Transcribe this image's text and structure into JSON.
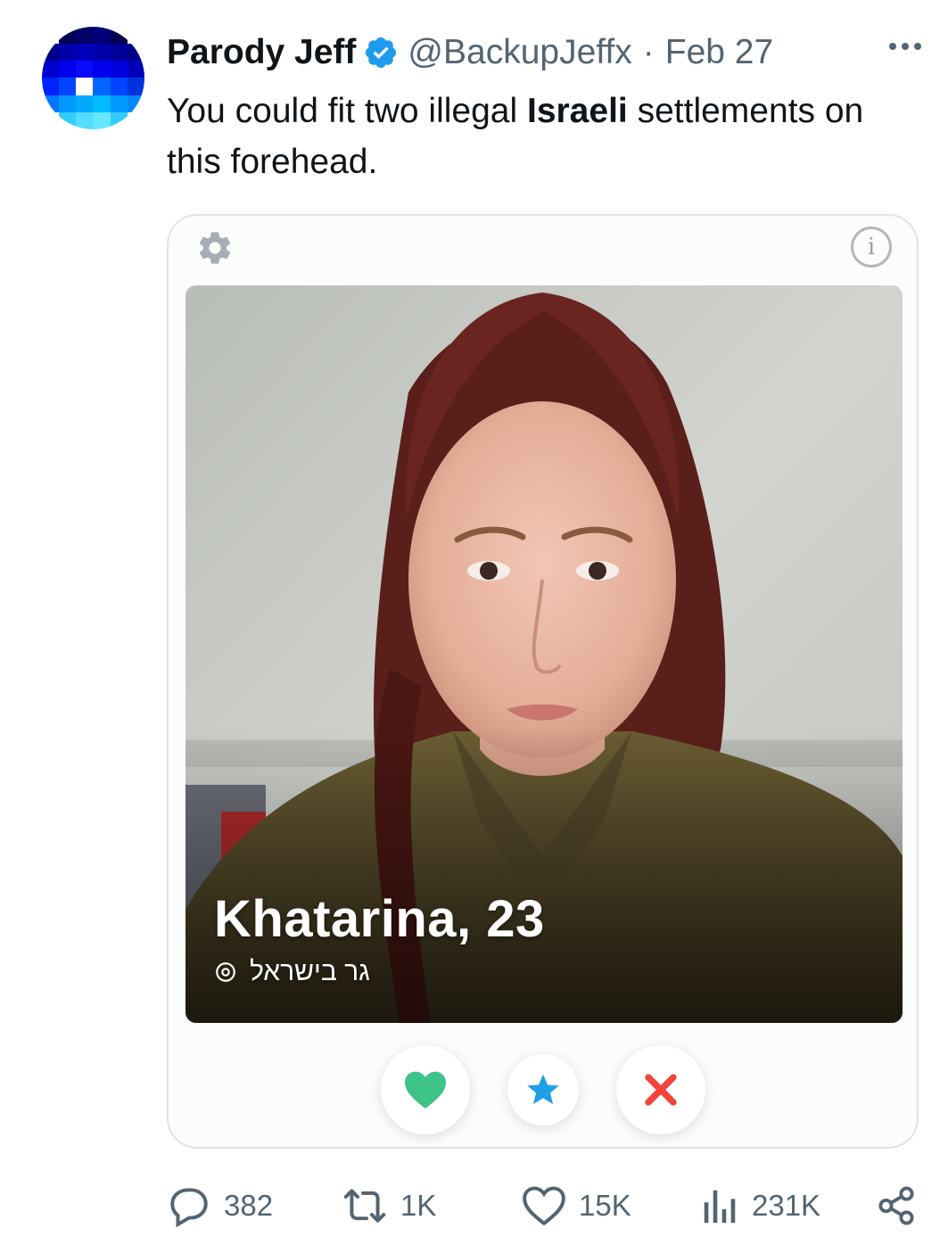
{
  "tweet": {
    "author_name": "Parody Jeff",
    "handle": "@BackupJeffx",
    "separator": "·",
    "date": "Feb 27",
    "text_before": "You could fit two illegal ",
    "text_bold": "Israeli",
    "text_after": " settlements on this forehead."
  },
  "avatar": {
    "palette": [
      "#000066",
      "#00007a",
      "#0000b3",
      "#0000cc",
      "#1a1aff",
      "#0033ff",
      "#0055ff",
      "#0077ff",
      "#0099ff",
      "#00bbff",
      "#33ccff",
      "#66e0ff"
    ]
  },
  "card": {
    "person_name": "Khatarina, 23",
    "location": "גר בישראל",
    "icons": [
      "gear-icon",
      "info-icon",
      "heart-icon",
      "star-icon",
      "close-icon",
      "location-pin-icon"
    ],
    "colors": {
      "heart": "#3ec489",
      "star": "#1fa0e6",
      "nope": "#f0453a"
    }
  },
  "engagement": {
    "replies": "382",
    "reposts": "1K",
    "likes": "15K",
    "views": "231K"
  },
  "colors": {
    "verified": "#1d9bf0",
    "muted": "#536471",
    "text": "#0f1419"
  }
}
